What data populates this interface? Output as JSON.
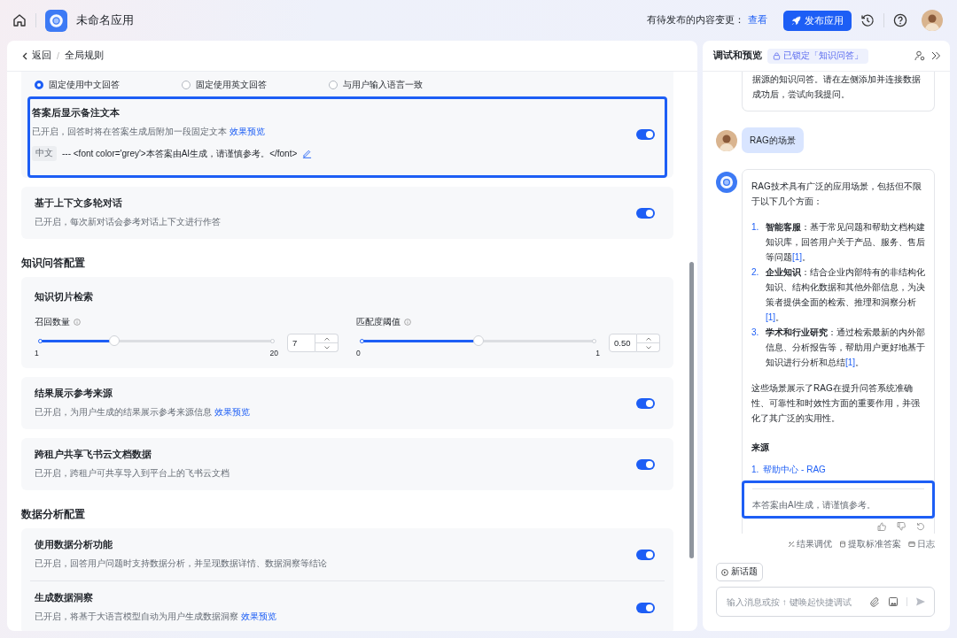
{
  "top_bar": {
    "app_name": "未命名应用",
    "pending_label": "有待发布的内容变更：",
    "pending_link": "查看",
    "publish_button": "发布应用"
  },
  "breadcrumb": {
    "back": "返回",
    "separator": "/",
    "current": "全局规则"
  },
  "sections": [
    {
      "cards": [
        {
          "items": [
            {
              "kind": "radio",
              "options": [
                {
                  "label": "固定使用中文回答",
                  "selected": true
                },
                {
                  "label": "固定使用英文回答",
                  "selected": false
                },
                {
                  "label": "与用户输入语言一致",
                  "selected": false
                }
              ]
            },
            {
              "kind": "toggle",
              "title": "答案后显示备注文本",
              "description": "已开启，回答时将在答案生成后附加一段固定文本",
              "link": "效果预览",
              "on": true,
              "highlighted": true,
              "note": {
                "tag": "中文",
                "text": "--- <font color='grey'>本答案由AI生成，请谨慎参考。</font>"
              }
            }
          ]
        },
        {
          "items": [
            {
              "kind": "toggle",
              "title": "基于上下文多轮对话",
              "description": "已开启，每次新对话会参考对话上下文进行作答",
              "on": true,
              "highlighted": false
            }
          ]
        }
      ]
    },
    {
      "title": "知识问答配置",
      "cards": [
        {
          "items": [
            {
              "kind": "sliders",
              "title": "知识切片检索",
              "sliders": [
                {
                  "label": "召回数量",
                  "min": "1",
                  "max": "20",
                  "value": "7",
                  "level": 0.32
                },
                {
                  "label": "匹配度阈值",
                  "min": "0",
                  "max": "1",
                  "value": "0.50",
                  "level": 0.5
                }
              ]
            }
          ]
        },
        {
          "items": [
            {
              "kind": "toggle",
              "title": "结果展示参考来源",
              "description": "已开启，为用户生成的结果展示参考来源信息",
              "link": "效果预览",
              "on": true,
              "highlighted": false
            }
          ]
        },
        {
          "items": [
            {
              "kind": "toggle",
              "title": "跨租户共享飞书云文档数据",
              "description": "已开启，跨租户可共享导入到平台上的飞书云文档",
              "on": true,
              "highlighted": false
            }
          ]
        }
      ]
    },
    {
      "title": "数据分析配置",
      "cards": [
        {
          "items": [
            {
              "kind": "toggle",
              "title": "使用数据分析功能",
              "description": "已开启，回答用户问题时支持数据分析，并呈现数据详情、数据洞察等结论",
              "on": true,
              "highlighted": false
            },
            {
              "kind": "toggle",
              "title": "生成数据洞察",
              "description": "已开启，将基于大语言模型自动为用户生成数据洞察",
              "link": "效果预览",
              "on": true,
              "highlighted": false
            }
          ]
        }
      ]
    }
  ],
  "preview": {
    "title": "调试和预览",
    "lock_tag": "已锁定「知识问答」",
    "messages": [
      {
        "kind": "bot_continued",
        "text": "据源的知识问答。请在左侧添加并连接数据成功后，尝试向我提问。"
      },
      {
        "kind": "user_text",
        "text": "RAG的场景"
      },
      {
        "kind": "answer",
        "intro": "RAG技术具有广泛的应用场景，包括但不限于以下几个方面：",
        "list": [
          {
            "number": "1.",
            "text": "**智能客服**：基于常见问题和帮助文档构建知识库，回答用户关于产品、服务、售后等问题",
            "ref": "[1]",
            "end": "。"
          },
          {
            "number": "2.",
            "text": "**企业知识**：结合企业内部特有的非结构化知识、结构化数据和其他外部信息，为决策者提供全面的检索、推理和洞察分析",
            "ref": "[1]",
            "end": "。"
          },
          {
            "number": "3.",
            "text": "**学术和行业研究**：通过检索最新的内外部信息、分析报告等，帮助用户更好地基于知识进行分析和总结",
            "ref": "[1]",
            "end": "。"
          }
        ],
        "conclusion": "这些场景展示了RAG在提升问答系统准确性、可靠性和时效性方面的重要作用，并强化了其广泛的实用性。",
        "sources_title": "来源",
        "sources": [
          {
            "number": "1.",
            "text": "帮助中心 - RAG"
          }
        ],
        "note": "本答案由AI生成，请谨慎参考。",
        "note_highlighted": true
      }
    ],
    "actions": [
      "结果调优",
      "提取标准答案",
      "日志"
    ],
    "new_topic": "新话题",
    "input": {
      "placeholder": "输入消息或按 ↑ 键唤起快捷调试"
    }
  }
}
